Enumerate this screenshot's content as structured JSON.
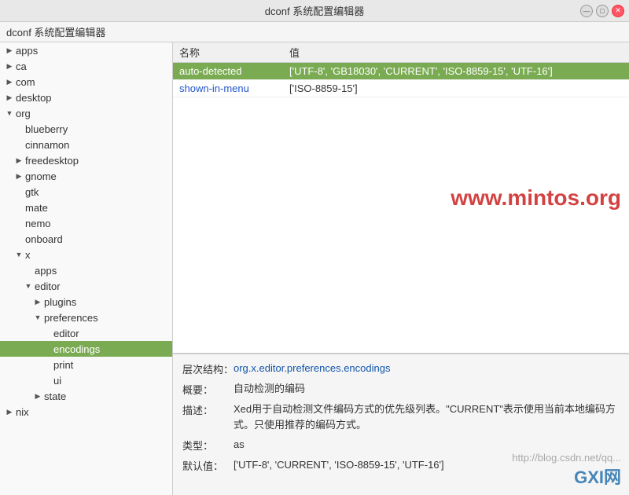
{
  "titlebar": {
    "title": "dconf 系统配置编辑器",
    "controls": [
      "minimize",
      "maximize",
      "close"
    ]
  },
  "menubar": {
    "label": "dconf 系统配置编辑器"
  },
  "sidebar": {
    "items": [
      {
        "id": "apps",
        "label": "apps",
        "indent": "indent-0",
        "expanded": false,
        "arrow": "▶",
        "selected": false
      },
      {
        "id": "ca",
        "label": "ca",
        "indent": "indent-0",
        "expanded": false,
        "arrow": "▶",
        "selected": false
      },
      {
        "id": "com",
        "label": "com",
        "indent": "indent-0",
        "expanded": false,
        "arrow": "▶",
        "selected": false
      },
      {
        "id": "desktop",
        "label": "desktop",
        "indent": "indent-0",
        "expanded": false,
        "arrow": "▶",
        "selected": false
      },
      {
        "id": "org",
        "label": "org",
        "indent": "indent-0",
        "expanded": true,
        "arrow": "▼",
        "selected": false
      },
      {
        "id": "blueberry",
        "label": "blueberry",
        "indent": "indent-1",
        "expanded": false,
        "arrow": "",
        "selected": false
      },
      {
        "id": "cinnamon",
        "label": "cinnamon",
        "indent": "indent-1",
        "expanded": false,
        "arrow": "",
        "selected": false
      },
      {
        "id": "freedesktop",
        "label": "freedesktop",
        "indent": "indent-1",
        "expanded": false,
        "arrow": "▶",
        "selected": false
      },
      {
        "id": "gnome",
        "label": "gnome",
        "indent": "indent-1",
        "expanded": false,
        "arrow": "▶",
        "selected": false
      },
      {
        "id": "gtk",
        "label": "gtk",
        "indent": "indent-1",
        "expanded": false,
        "arrow": "",
        "selected": false
      },
      {
        "id": "mate",
        "label": "mate",
        "indent": "indent-1",
        "expanded": false,
        "arrow": "",
        "selected": false
      },
      {
        "id": "nemo",
        "label": "nemo",
        "indent": "indent-1",
        "expanded": false,
        "arrow": "",
        "selected": false
      },
      {
        "id": "onboard",
        "label": "onboard",
        "indent": "indent-1",
        "expanded": false,
        "arrow": "",
        "selected": false
      },
      {
        "id": "x",
        "label": "x",
        "indent": "indent-1",
        "expanded": true,
        "arrow": "▼",
        "selected": false
      },
      {
        "id": "x-apps",
        "label": "apps",
        "indent": "indent-2",
        "expanded": false,
        "arrow": "",
        "selected": false
      },
      {
        "id": "x-editor",
        "label": "editor",
        "indent": "indent-2",
        "expanded": true,
        "arrow": "▼",
        "selected": false
      },
      {
        "id": "x-editor-plugins",
        "label": "plugins",
        "indent": "indent-3",
        "expanded": false,
        "arrow": "▶",
        "selected": false
      },
      {
        "id": "x-editor-preferences",
        "label": "preferences",
        "indent": "indent-3",
        "expanded": true,
        "arrow": "▼",
        "selected": false
      },
      {
        "id": "x-editor-preferences-editor",
        "label": "editor",
        "indent": "indent-4",
        "expanded": false,
        "arrow": "",
        "selected": false
      },
      {
        "id": "x-editor-preferences-encodings",
        "label": "encodings",
        "indent": "indent-4",
        "expanded": false,
        "arrow": "",
        "selected": true
      },
      {
        "id": "x-editor-preferences-print",
        "label": "print",
        "indent": "indent-4",
        "expanded": false,
        "arrow": "",
        "selected": false
      },
      {
        "id": "x-editor-preferences-ui",
        "label": "ui",
        "indent": "indent-4",
        "expanded": false,
        "arrow": "",
        "selected": false
      },
      {
        "id": "x-editor-state",
        "label": "state",
        "indent": "indent-3",
        "expanded": false,
        "arrow": "▶",
        "selected": false
      },
      {
        "id": "nix",
        "label": "nix",
        "indent": "indent-0",
        "expanded": false,
        "arrow": "▶",
        "selected": false
      }
    ]
  },
  "table": {
    "headers": [
      {
        "id": "name",
        "label": "名称"
      },
      {
        "id": "value",
        "label": "值"
      }
    ],
    "rows": [
      {
        "id": "auto-detected",
        "name": "auto-detected",
        "value": "['UTF-8', 'GB18030', 'CURRENT', 'ISO-8859-15', 'UTF-16']",
        "selected": true
      },
      {
        "id": "shown-in-menu",
        "name": "shown-in-menu",
        "value": "['ISO-8859-15']",
        "selected": false
      }
    ]
  },
  "watermark": {
    "text": "www.mintos.org"
  },
  "info": {
    "path_label": "层次结构：",
    "path_value": "org.x.editor.preferences.encodings",
    "summary_label": "概要：",
    "summary_value": "自动检测的编码",
    "desc_label": "描述：",
    "desc_value": "Xed用于自动检测文件编码方式的优先级列表。\"CURRENT\"表示使用当前本地编码方式。只使用推荐的编码方式。",
    "type_label": "类型：",
    "type_value": "as",
    "default_label": "默认值：",
    "default_value": "['UTF-8', 'CURRENT', 'ISO-8859-15', 'UTF-16']"
  },
  "watermark_bottom": {
    "url": "http://blog.csdn.net/qq...",
    "logo": "GXI网"
  }
}
